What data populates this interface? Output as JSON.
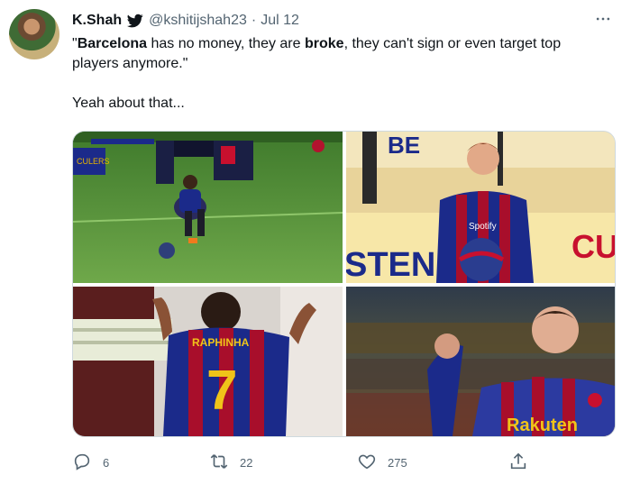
{
  "author": {
    "name": "K.Shah",
    "handle": "@kshitijshah23",
    "separator": "·",
    "date": "Jul 12"
  },
  "tweet": {
    "line1_bold_a": "Barcelona",
    "line1_a": " has no money, they are ",
    "line1_bold_b": "broke",
    "line1_b": ", they can't sign or even target top players anymore.\"",
    "quote_open": "\"",
    "line2": "Yeah about that..."
  },
  "media": {
    "img2_text_top": "BE",
    "img2_text_bottom": "STEN",
    "img2_text_right": "CU",
    "img2_sponsor": "Spotify",
    "img3_name": "RAPHINHA",
    "img3_number": "7",
    "img4_sponsor": "Rakuten",
    "img1_banner": "CULERS"
  },
  "actions": {
    "replies": "6",
    "retweets": "22",
    "likes": "275"
  },
  "colors": {
    "text_primary": "#0f1419",
    "text_secondary": "#536471",
    "verified": "#1d9bf0",
    "barca_blue": "#1b2a8a",
    "barca_red": "#b3122e"
  }
}
